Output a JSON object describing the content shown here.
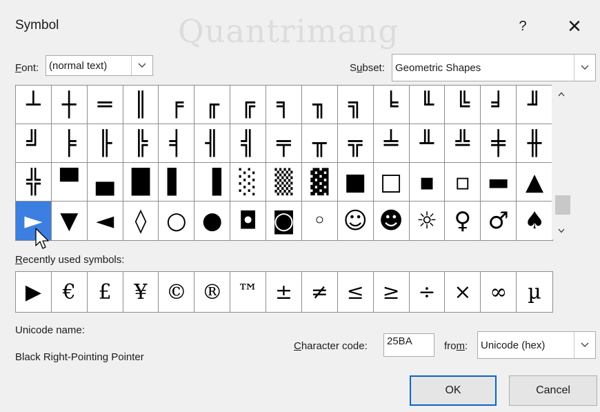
{
  "dialog": {
    "title": "Symbol",
    "help_label": "?",
    "close_label": "✕",
    "watermark": "Quantrimang"
  },
  "font": {
    "label_prefix": "",
    "label_accel": "F",
    "label_rest": "ont:",
    "value": "(normal text)"
  },
  "subset": {
    "label_prefix": "S",
    "label_accel": "u",
    "label_rest": "bset:",
    "value": "Geometric Shapes"
  },
  "icons": {
    "dropdown": "⌵",
    "scroll_up": "˄",
    "scroll_down": "˅"
  },
  "symbols": [
    [
      "┴",
      "┼",
      "═",
      "║",
      "╒",
      "╓",
      "╔",
      "╕",
      "╖",
      "╗",
      "╘",
      "╙",
      "╚",
      "╛",
      "╜"
    ],
    [
      "╝",
      "╞",
      "╟",
      "╠",
      "╡",
      "╢",
      "╣",
      "╤",
      "╥",
      "╦",
      "╧",
      "╨",
      "╩",
      "╪",
      "╫"
    ],
    [
      "╬",
      "▀",
      "▄",
      "█",
      "▌",
      "▐",
      "░",
      "▒",
      "▓",
      "■",
      "□",
      "▪",
      "▫",
      "▬",
      "▲"
    ],
    [
      "►",
      "▼",
      "◄",
      "◊",
      "○",
      "●",
      "◘",
      "◙",
      "◦",
      "☺",
      "☻",
      "☼",
      "♀",
      "♂",
      "♠"
    ]
  ],
  "selected": {
    "row": 3,
    "col": 0
  },
  "recent": {
    "label_accel": "R",
    "label_rest": "ecently used symbols:",
    "symbols": [
      "▶",
      "€",
      "£",
      "¥",
      "©",
      "®",
      "™",
      "±",
      "≠",
      "≤",
      "≥",
      "÷",
      "×",
      "∞",
      "µ"
    ]
  },
  "unicode": {
    "name_label": "Unicode name:",
    "name_value": "Black Right-Pointing Pointer"
  },
  "char_code": {
    "label_accel": "C",
    "label_rest": "haracter code:",
    "value": "25BA"
  },
  "from": {
    "label_pre": "fro",
    "label_accel": "m",
    "label_post": ":",
    "value": "Unicode (hex)"
  },
  "buttons": {
    "ok": "OK",
    "cancel": "Cancel"
  },
  "colors": {
    "selection": "#3d7fe0",
    "default_border": "#0a64c8"
  }
}
